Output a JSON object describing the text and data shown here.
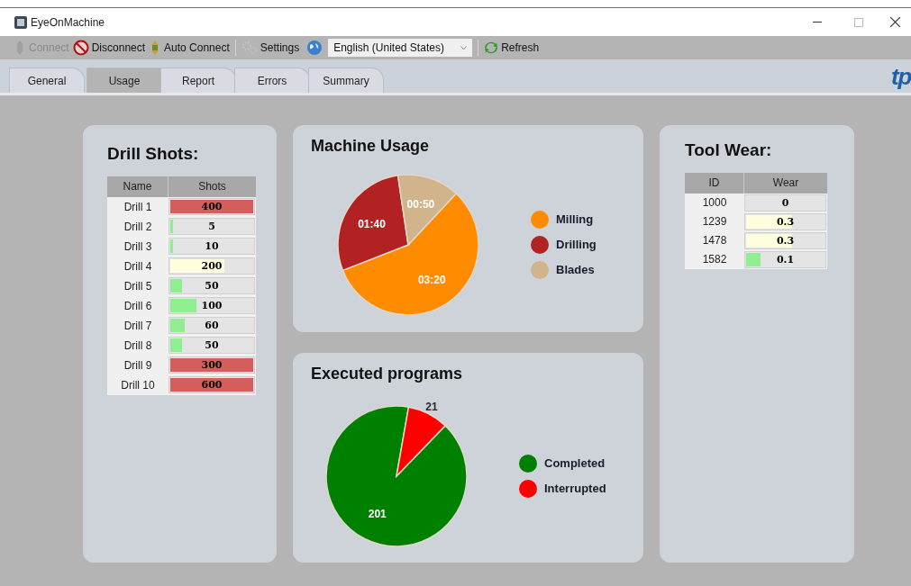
{
  "window": {
    "title": "EyeOnMachine"
  },
  "toolbar": {
    "buttons": [
      {
        "label": "Connect",
        "disabled": true
      },
      {
        "label": "Disconnect",
        "disabled": false
      },
      {
        "label": "Auto Connect",
        "disabled": false
      },
      {
        "label": "Settings",
        "disabled": false
      }
    ],
    "language": {
      "value": "English (United States)"
    },
    "refresh": {
      "label": "Refresh"
    }
  },
  "tabs": [
    {
      "label": "General",
      "selected": false
    },
    {
      "label": "Usage",
      "selected": true
    },
    {
      "label": "Report",
      "selected": false
    },
    {
      "label": "Errors",
      "selected": false
    },
    {
      "label": "Summary",
      "selected": false
    }
  ],
  "logo": {
    "text": "tp"
  },
  "drill_shots": {
    "title": "Drill Shots:",
    "columns": [
      "Name",
      "Shots"
    ],
    "rows": [
      {
        "name": "Drill 1",
        "shots": "400",
        "level": 1,
        "color": "#d45f5a"
      },
      {
        "name": "Drill 2",
        "shots": "5",
        "level": 0.02,
        "color": "#90ee90"
      },
      {
        "name": "Drill 3",
        "shots": "10",
        "level": 0.03,
        "color": "#90ee90"
      },
      {
        "name": "Drill 4",
        "shots": "200",
        "level": 0.66,
        "color": "#ffffe0"
      },
      {
        "name": "Drill 5",
        "shots": "50",
        "level": 0.16,
        "color": "#90ee90"
      },
      {
        "name": "Drill 6",
        "shots": "100",
        "level": 0.33,
        "color": "#90ee90"
      },
      {
        "name": "Drill 7",
        "shots": "60",
        "level": 0.19,
        "color": "#90ee90"
      },
      {
        "name": "Drill 8",
        "shots": "50",
        "level": 0.16,
        "color": "#90ee90"
      },
      {
        "name": "Drill 9",
        "shots": "300",
        "level": 1,
        "color": "#d45f5a"
      },
      {
        "name": "Drill 10",
        "shots": "600",
        "level": 1,
        "color": "#d45f5a"
      }
    ]
  },
  "machine_usage": {
    "title": "Machine Usage",
    "chart_data": {
      "type": "pie",
      "categories": [
        "Milling",
        "Drilling",
        "Blades"
      ],
      "series": [
        {
          "color": [
            "#ff8c00",
            "#b22222",
            "#d2b48c"
          ],
          "values": [
            57.14,
            28.57,
            14.29
          ]
        }
      ],
      "value_labels": [
        "03:20",
        "01:40",
        "00:50"
      ],
      "legend": "right"
    }
  },
  "executed_programs": {
    "title": "Executed programs",
    "chart_data": {
      "type": "pie",
      "categories": [
        "Completed",
        "Interrupted"
      ],
      "series": [
        {
          "color": [
            "#008000",
            "#ff0000"
          ],
          "values": [
            201,
            21
          ]
        }
      ],
      "data_labels": true,
      "legend": "right"
    }
  },
  "tool_wear": {
    "title": "Tool Wear:",
    "columns": [
      "ID",
      "Wear"
    ],
    "rows": [
      {
        "id": "1000",
        "wear": "0"
      },
      {
        "id": "1239",
        "wear": "0.3",
        "level": 0.6,
        "color": "#ffffe0"
      },
      {
        "id": "1478",
        "wear": "0.3",
        "level": 0.6,
        "color": "#ffffe0"
      },
      {
        "id": "1582",
        "wear": "0.1",
        "level": 0.2,
        "color": "#90ee90"
      }
    ]
  }
}
